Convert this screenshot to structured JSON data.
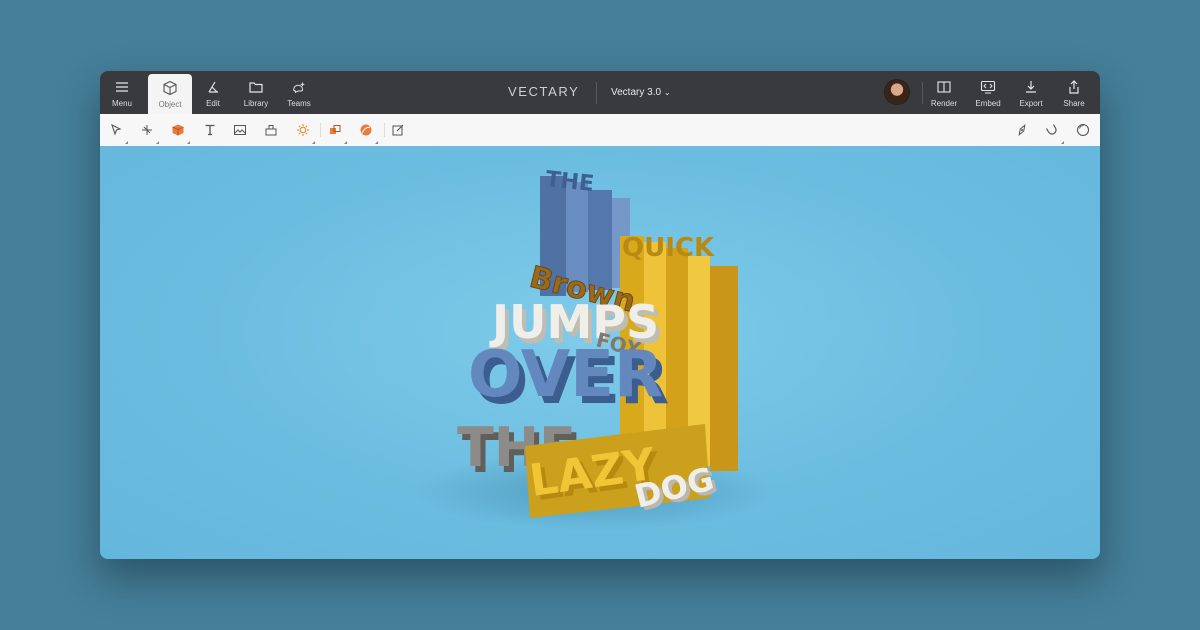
{
  "topbar": {
    "menu_label": "Menu",
    "object_label": "Object",
    "edit_label": "Edit",
    "library_label": "Library",
    "teams_label": "Teams",
    "brand": "VECTARY",
    "doc_title": "Vectary 3.0",
    "render_label": "Render",
    "embed_label": "Embed",
    "export_label": "Export",
    "share_label": "Share"
  },
  "scene": {
    "words": {
      "the_top": "THE",
      "quick": "QUICK",
      "brown": "Brown",
      "fox": "FOX",
      "jumps": "JUMPS",
      "over": "OVER",
      "the_bottom": "THE",
      "lazy": "LAZY",
      "dog": "DOG"
    }
  },
  "icons": {
    "toolbar_left": [
      "select-icon",
      "pen-tool-icon",
      "cube-icon",
      "text-icon",
      "image-icon",
      "component-icon",
      "light-icon",
      "boolean-icon",
      "material-icon",
      "edit-box-icon"
    ],
    "toolbar_right": [
      "compass-icon",
      "magnet-icon",
      "sphere-icon"
    ]
  },
  "colors": {
    "topbar": "#383a3d",
    "toolbar": "#f7f7f7",
    "viewport": "#6bbde0",
    "blue_letters": "#5c7fb0",
    "yellow_letters": "#e3b624",
    "brown_letters": "#9a6a1c",
    "white_letters": "#ecebe6",
    "grey_letters": "#8a8a88"
  }
}
